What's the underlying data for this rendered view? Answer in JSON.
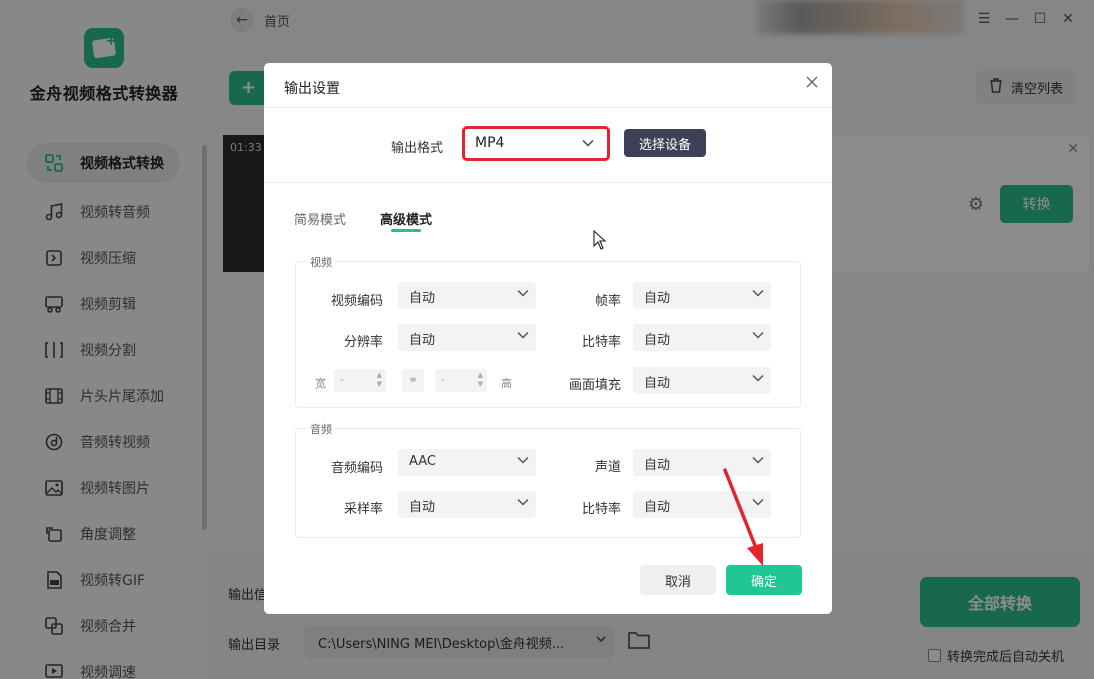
{
  "app": {
    "name": "金舟视频格式转换器",
    "breadcrumb": "首页",
    "add_button_label": "+",
    "clear_list_label": "清空列表",
    "thumbnail_time": "01:33",
    "convert_label": "转换",
    "output_info_label": "输出信",
    "output_dir_label": "输出目录",
    "output_dir_value": "C:\\Users\\NING MEI\\Desktop\\金舟视频...",
    "convert_all_label": "全部转换",
    "auto_shutdown_label": "转换完成后自动关机"
  },
  "sidebar": {
    "items": [
      {
        "label": "视频格式转换",
        "icon": "video-convert-icon",
        "active": true
      },
      {
        "label": "视频转音频",
        "icon": "video-to-audio-icon",
        "active": false
      },
      {
        "label": "视频压缩",
        "icon": "video-compress-icon",
        "active": false
      },
      {
        "label": "视频剪辑",
        "icon": "video-edit-icon",
        "active": false
      },
      {
        "label": "视频分割",
        "icon": "video-split-icon",
        "active": false
      },
      {
        "label": "片头片尾添加",
        "icon": "intro-outro-icon",
        "active": false
      },
      {
        "label": "音频转视频",
        "icon": "audio-to-video-icon",
        "active": false
      },
      {
        "label": "视频转图片",
        "icon": "video-to-image-icon",
        "active": false
      },
      {
        "label": "角度调整",
        "icon": "rotate-icon",
        "active": false
      },
      {
        "label": "视频转GIF",
        "icon": "gif-icon",
        "active": false
      },
      {
        "label": "视频合并",
        "icon": "merge-icon",
        "active": false
      },
      {
        "label": "视频调速",
        "icon": "speed-icon",
        "active": false
      }
    ]
  },
  "dialog": {
    "title": "输出设置",
    "format_label": "输出格式",
    "format_value": "MP4",
    "select_device_label": "选择设备",
    "tabs": [
      {
        "label": "简易模式",
        "active": false
      },
      {
        "label": "高级模式",
        "active": true
      }
    ],
    "video": {
      "title": "视频",
      "codec_label": "视频编码",
      "codec_value": "自动",
      "framerate_label": "帧率",
      "framerate_value": "自动",
      "resolution_label": "分辨率",
      "resolution_value": "自动",
      "bitrate_label": "比特率",
      "bitrate_value": "自动",
      "width_label": "宽",
      "width_value": "-",
      "height_label": "高",
      "height_value": "-",
      "fill_label": "画面填充",
      "fill_value": "自动"
    },
    "audio": {
      "title": "音频",
      "codec_label": "音频编码",
      "codec_value": "AAC",
      "channel_label": "声道",
      "channel_value": "自动",
      "samplerate_label": "采样率",
      "samplerate_value": "自动",
      "bitrate_label": "比特率",
      "bitrate_value": "自动"
    },
    "cancel_label": "取消",
    "ok_label": "确定"
  },
  "colors": {
    "accent": "#2dbd8f",
    "highlight_box": "#e1252b",
    "annotation_arrow": "#e1252b",
    "device_button": "#3d4157"
  }
}
